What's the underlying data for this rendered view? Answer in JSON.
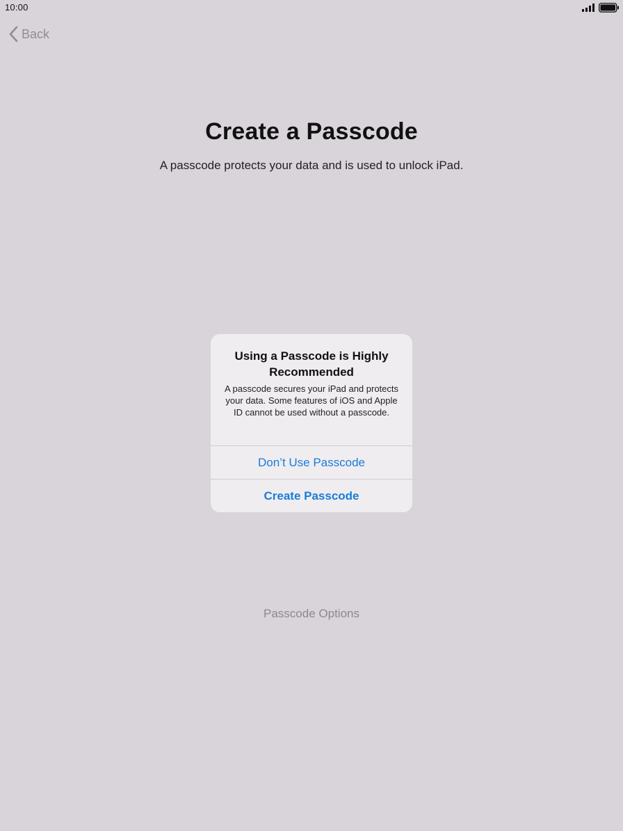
{
  "status_bar": {
    "time": "10:00",
    "signal_icon": "cellular-signal-icon",
    "battery_icon": "battery-full-icon"
  },
  "nav": {
    "back_label": "Back",
    "back_icon": "chevron-left-icon"
  },
  "main": {
    "title": "Create a Passcode",
    "subtitle": "A passcode protects your data and is used to unlock iPad.",
    "options_link": "Passcode Options"
  },
  "alert": {
    "title": "Using a Passcode is Highly Recommended",
    "message": "A passcode secures your iPad and protects your data. Some features of iOS and Apple ID cannot be used without a passcode.",
    "buttons": [
      {
        "label": "Don’t Use Passcode"
      },
      {
        "label": "Create Passcode"
      }
    ]
  },
  "colors": {
    "background": "#d8d4d9",
    "accent": "#1a7cd7",
    "alert_bg": "#efedf0",
    "muted": "#8e8e93"
  }
}
